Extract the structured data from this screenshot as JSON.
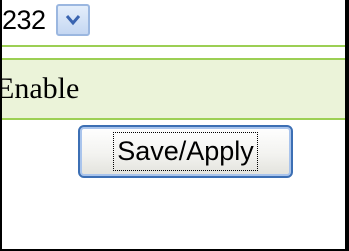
{
  "select": {
    "value": "232",
    "arrow_icon": "chevron-down-icon"
  },
  "option": {
    "label": "Enable"
  },
  "actions": {
    "save_apply_label": "Save/Apply"
  },
  "colors": {
    "accent_green": "#9ccf54",
    "band_background": "#ebf3d9",
    "button_border": "#3c6fb4"
  }
}
